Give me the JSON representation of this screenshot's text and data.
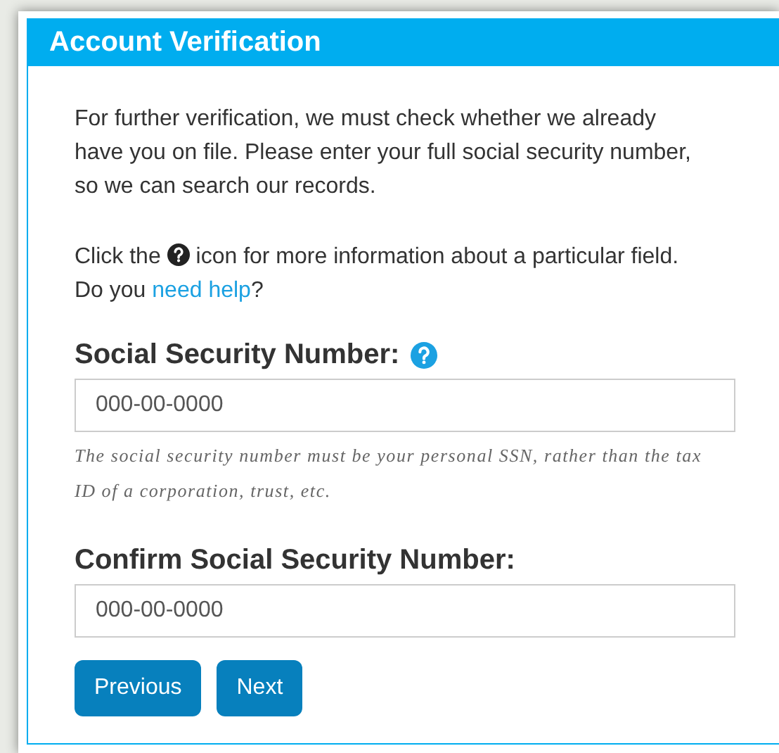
{
  "dialog": {
    "title": "Account Verification"
  },
  "intro": "For further verification, we must check whether we already have you on file. Please enter your full social security number, so we can search our records.",
  "info_line": {
    "before": "Click the",
    "after": "icon for more information about a particular field."
  },
  "help_line": {
    "before": "Do you",
    "link": "need help",
    "after": "?"
  },
  "fields": [
    {
      "label": "Social Security Number:",
      "has_help": true,
      "placeholder": "000-00-0000",
      "hint": "The social security number must be your personal SSN, rather than the tax ID of a corporation, trust, etc."
    },
    {
      "label": "Confirm Social Security Number:",
      "has_help": false,
      "placeholder": "000-00-0000"
    }
  ],
  "buttons": [
    "Previous",
    "Next"
  ]
}
